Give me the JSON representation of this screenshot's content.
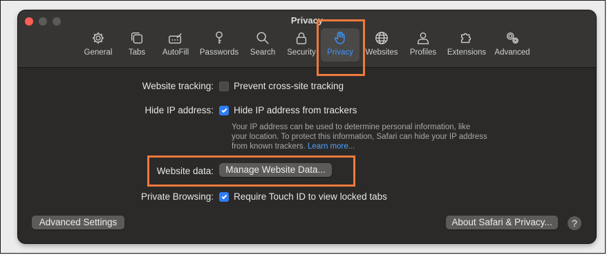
{
  "window": {
    "title": "Privacy"
  },
  "tabs": [
    {
      "label": "General",
      "icon": "gear-icon"
    },
    {
      "label": "Tabs",
      "icon": "tabs-icon"
    },
    {
      "label": "AutoFill",
      "icon": "autofill-pencil-icon"
    },
    {
      "label": "Passwords",
      "icon": "key-icon"
    },
    {
      "label": "Search",
      "icon": "search-icon"
    },
    {
      "label": "Security",
      "icon": "lock-icon"
    },
    {
      "label": "Privacy",
      "icon": "hand-icon",
      "selected": true
    },
    {
      "label": "Websites",
      "icon": "globe-icon"
    },
    {
      "label": "Profiles",
      "icon": "person-icon"
    },
    {
      "label": "Extensions",
      "icon": "puzzle-icon"
    },
    {
      "label": "Advanced",
      "icon": "gears-icon"
    }
  ],
  "settings": {
    "website_tracking": {
      "label": "Website tracking:",
      "option": "Prevent cross-site tracking",
      "checked": false
    },
    "hide_ip": {
      "label": "Hide IP address:",
      "option": "Hide IP address from trackers",
      "checked": true,
      "description": "Your IP address can be used to determine personal information, like your location. To protect this information, Safari can hide your IP address from known trackers.",
      "learn_more": "Learn more..."
    },
    "website_data": {
      "label": "Website data:",
      "button": "Manage Website Data..."
    },
    "private_browsing": {
      "label": "Private Browsing:",
      "option": "Require Touch ID to view locked tabs",
      "checked": true
    }
  },
  "footer": {
    "advanced_button": "Advanced Settings",
    "about_button": "About Safari & Privacy...",
    "help": "?"
  },
  "colors": {
    "accent": "#2f7cf6",
    "highlight": "#ef7a3b",
    "link": "#4da3ff"
  }
}
